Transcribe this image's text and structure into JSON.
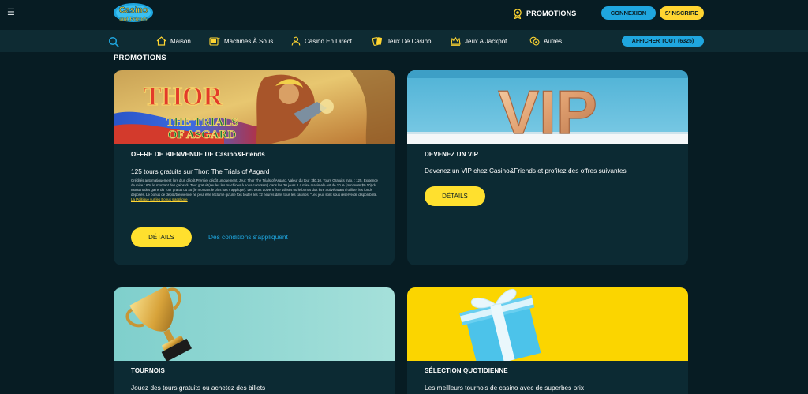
{
  "header": {
    "logo_text_1": "Casino",
    "logo_text_2": "and Friends",
    "promotions_label": "PROMOTIONS",
    "login_label": "CONNEXION",
    "signup_label": "S'INSCRIRE"
  },
  "nav": {
    "items": [
      {
        "label": "Maison",
        "icon": "home-icon"
      },
      {
        "label": "Machines À Sous",
        "icon": "slot-machine-icon"
      },
      {
        "label": "Casino En Direct",
        "icon": "live-dealer-icon"
      },
      {
        "label": "Jeux De Casino",
        "icon": "cards-icon"
      },
      {
        "label": "Jeux A Jackpot",
        "icon": "jackpot-icon"
      },
      {
        "label": "Autres",
        "icon": "chips-icon"
      }
    ],
    "show_all_label": "AFFICHER TOUT (6325)"
  },
  "page": {
    "section_title": "PROMOTIONS"
  },
  "cards": [
    {
      "image_text_1": "THOR",
      "image_text_2": "THE TRIALS",
      "image_text_3": "OF ASGARD",
      "title": "OFFRE DE BIENVENUE DE Casino&Friends",
      "subtitle": "125 tours gratuits sur Thor: The Trials of Asgard",
      "terms": "Crédités automatiquement lors d'un dépôt.Premier dépôt uniquement. Jeu : Thor The Trials of Asgard. Valeur du tour : $0.10. Tours Gratuits max. : 125. Exigence de mise : 60x le montant des gains du Tour gratuit (seules les machines à sous comptent) dans les 30 jours. La mise maximale est de 10 % (minimum $0.10) du montant des gains du Tour gratuit ou $5 (le montant le plus bas s'applique). Les tours doivent être utilisés ou le bonus doit être activé avant d'utiliser les fonds déposés. Le bonus de dépôt/bienvenue ne peut être réclamé qu'une fois toutes les 72 heures dans tous les casinos. \"Les jeux sont sous réserve de disponibilité.",
      "terms_link": "La Politique sur les Bonus s'applique",
      "button_label": "DÉTAILS",
      "conditions_label": "Des conditions s'appliquent"
    },
    {
      "image_text": "VIP",
      "title": "DEVENEZ UN VIP",
      "subtitle": "Devenez un VIP chez Casino&Friends et profitez des offres suivantes",
      "button_label": "DÉTAILS"
    },
    {
      "title": "TOURNOIS",
      "subtitle": "Jouez des tours gratuits ou achetez des billets"
    },
    {
      "title": "SÉLECTION QUOTIDIENNE",
      "subtitle": "Les meilleurs tournois de casino avec de superbes prix"
    }
  ],
  "colors": {
    "background": "#071c23",
    "card": "#0c2a33",
    "accent_yellow": "#ffe02e",
    "accent_blue": "#1fa6df"
  }
}
